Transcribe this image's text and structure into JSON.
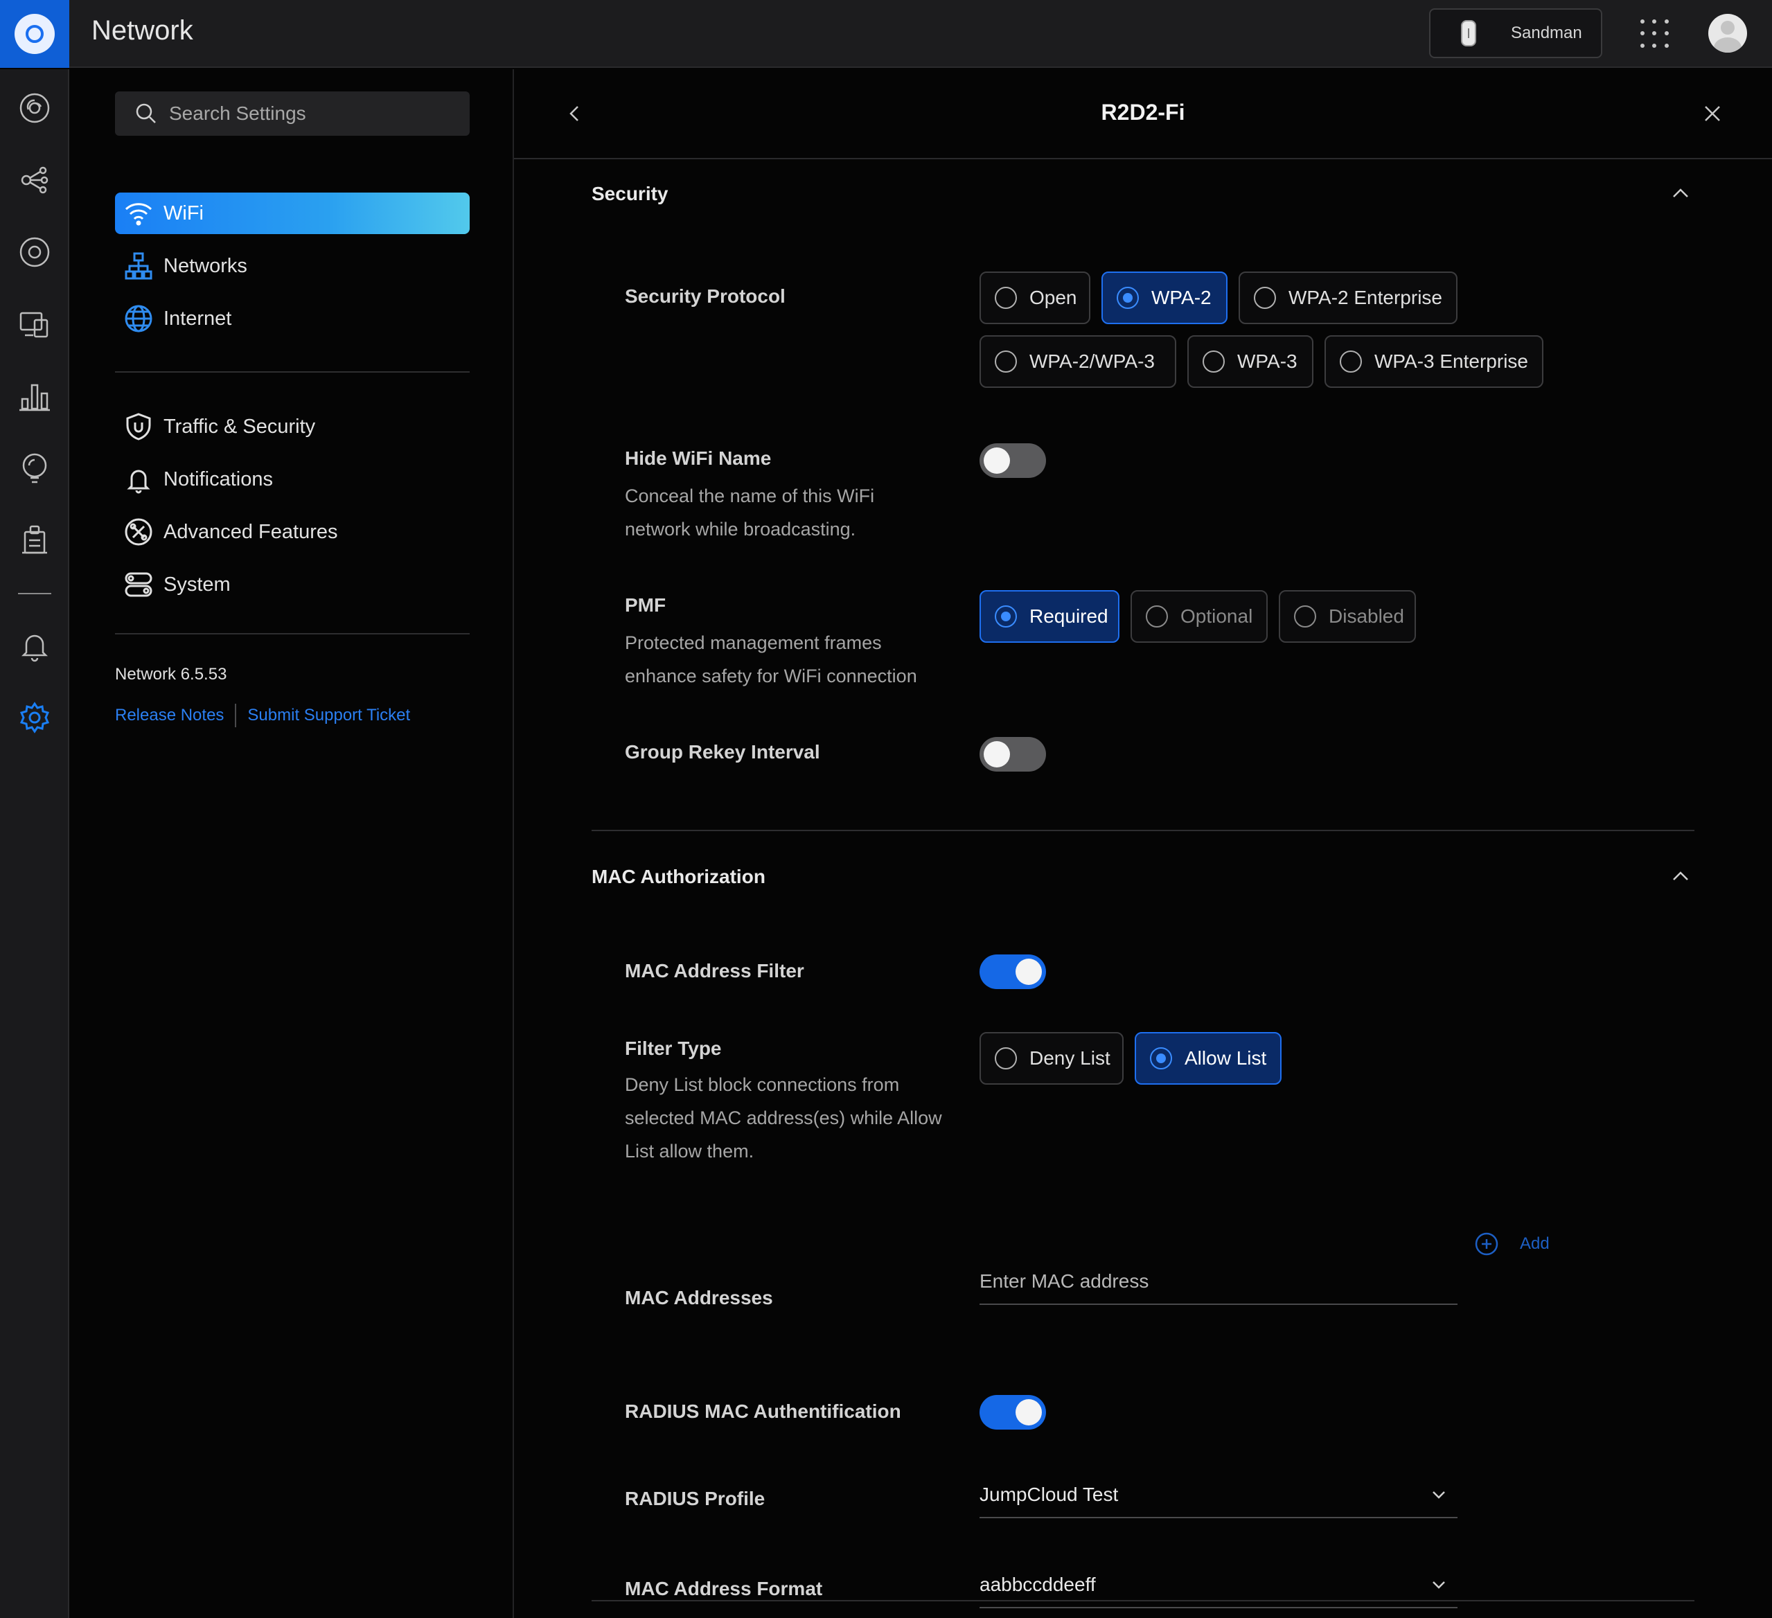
{
  "app": {
    "title": "Network"
  },
  "topbar": {
    "device_name": "Sandman"
  },
  "search": {
    "placeholder": "Search Settings"
  },
  "nav": {
    "primary": [
      {
        "label": "WiFi",
        "icon": "wifi-icon",
        "active": true
      },
      {
        "label": "Networks",
        "icon": "networks-icon"
      },
      {
        "label": "Internet",
        "icon": "globe-icon"
      }
    ],
    "secondary": [
      {
        "label": "Traffic & Security",
        "icon": "shield-icon"
      },
      {
        "label": "Notifications",
        "icon": "bell-icon"
      },
      {
        "label": "Advanced Features",
        "icon": "advanced-features-icon"
      },
      {
        "label": "System",
        "icon": "system-icon"
      }
    ],
    "version": "Network 6.5.53",
    "release_notes": "Release Notes",
    "support_ticket": "Submit Support Ticket"
  },
  "panel": {
    "title": "R2D2-Fi"
  },
  "security": {
    "title": "Security",
    "protocol": {
      "label": "Security Protocol",
      "options": [
        "Open",
        "WPA-2",
        "WPA-2 Enterprise",
        "WPA-2/WPA-3",
        "WPA-3",
        "WPA-3 Enterprise"
      ],
      "selected": "WPA-2"
    },
    "hide_wifi": {
      "label": "Hide WiFi Name",
      "description": "Conceal the name of this WiFi network while broadcasting.",
      "enabled": false
    },
    "pmf": {
      "label": "PMF",
      "description": "Protected management frames enhance safety for WiFi connection",
      "options": [
        "Required",
        "Optional",
        "Disabled"
      ],
      "selected": "Required"
    },
    "group_rekey": {
      "label": "Group Rekey Interval",
      "enabled": false
    }
  },
  "mac_auth": {
    "title": "MAC Authorization",
    "filter": {
      "label": "MAC Address Filter",
      "enabled": true
    },
    "filter_type": {
      "label": "Filter Type",
      "description": "Deny List block connections from selected MAC address(es) while Allow List allow them.",
      "options": [
        "Deny List",
        "Allow List"
      ],
      "selected": "Allow List"
    },
    "addresses": {
      "label": "MAC Addresses",
      "placeholder": "Enter MAC address",
      "add_label": "Add"
    },
    "radius_mac": {
      "label": "RADIUS MAC Authentification",
      "enabled": true
    },
    "radius_profile": {
      "label": "RADIUS Profile",
      "value": "JumpCloud Test"
    },
    "mac_format": {
      "label": "MAC Address Format",
      "value": "aabbccddeeff"
    }
  },
  "colors": {
    "accent": "#1568e6",
    "selected_bg": "#0a2a66",
    "link": "#2b7ff2"
  }
}
